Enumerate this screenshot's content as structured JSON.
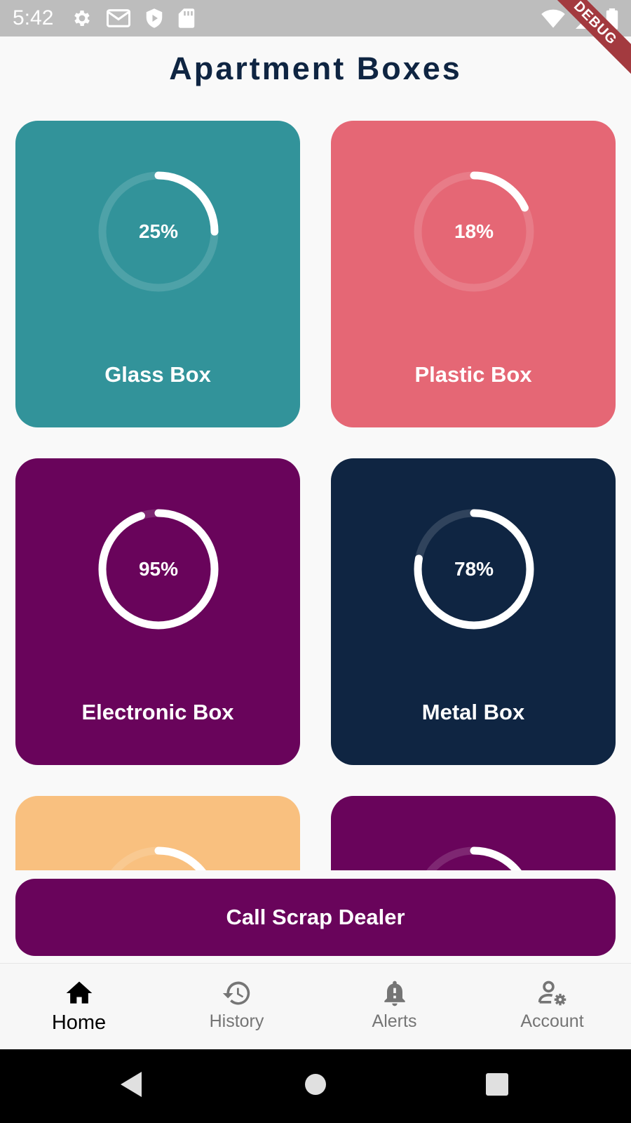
{
  "status_bar": {
    "time": "5:42",
    "icons": [
      "gear-icon",
      "gmail-icon",
      "shield-play-icon",
      "sd-card-icon",
      "wifi-icon",
      "signal-icon",
      "battery-icon"
    ],
    "color": "#bdbdbd"
  },
  "debug_banner": "DEBUG",
  "header": {
    "title": "Apartment Boxes"
  },
  "boxes": [
    {
      "name": "Glass Box",
      "percent_label": "25%",
      "fill": 0.25,
      "color": "#32939a"
    },
    {
      "name": "Plastic Box",
      "percent_label": "18%",
      "fill": 0.18,
      "color": "#e56775"
    },
    {
      "name": "Electronic Box",
      "percent_label": "95%",
      "fill": 0.95,
      "color": "#69045b"
    },
    {
      "name": "Metal Box",
      "percent_label": "78%",
      "fill": 0.78,
      "color": "#0f2542"
    },
    {
      "fill": 0.25,
      "color": "#f9c07f"
    },
    {
      "fill": 0.25,
      "color": "#69045b"
    }
  ],
  "actions": {
    "call_button": "Call Scrap Dealer"
  },
  "bottom_nav": {
    "items": [
      {
        "label": "Home",
        "icon": "home-icon",
        "active": true
      },
      {
        "label": "History",
        "icon": "history-icon",
        "active": false
      },
      {
        "label": "Alerts",
        "icon": "alert-bell-icon",
        "active": false
      },
      {
        "label": "Account",
        "icon": "account-settings-icon",
        "active": false
      }
    ]
  },
  "system_nav": [
    "back-icon",
    "home-circle-icon",
    "recents-icon"
  ],
  "colors": {
    "title": "#0f2542",
    "background": "#f9f9f9",
    "accent": "#69045b"
  }
}
